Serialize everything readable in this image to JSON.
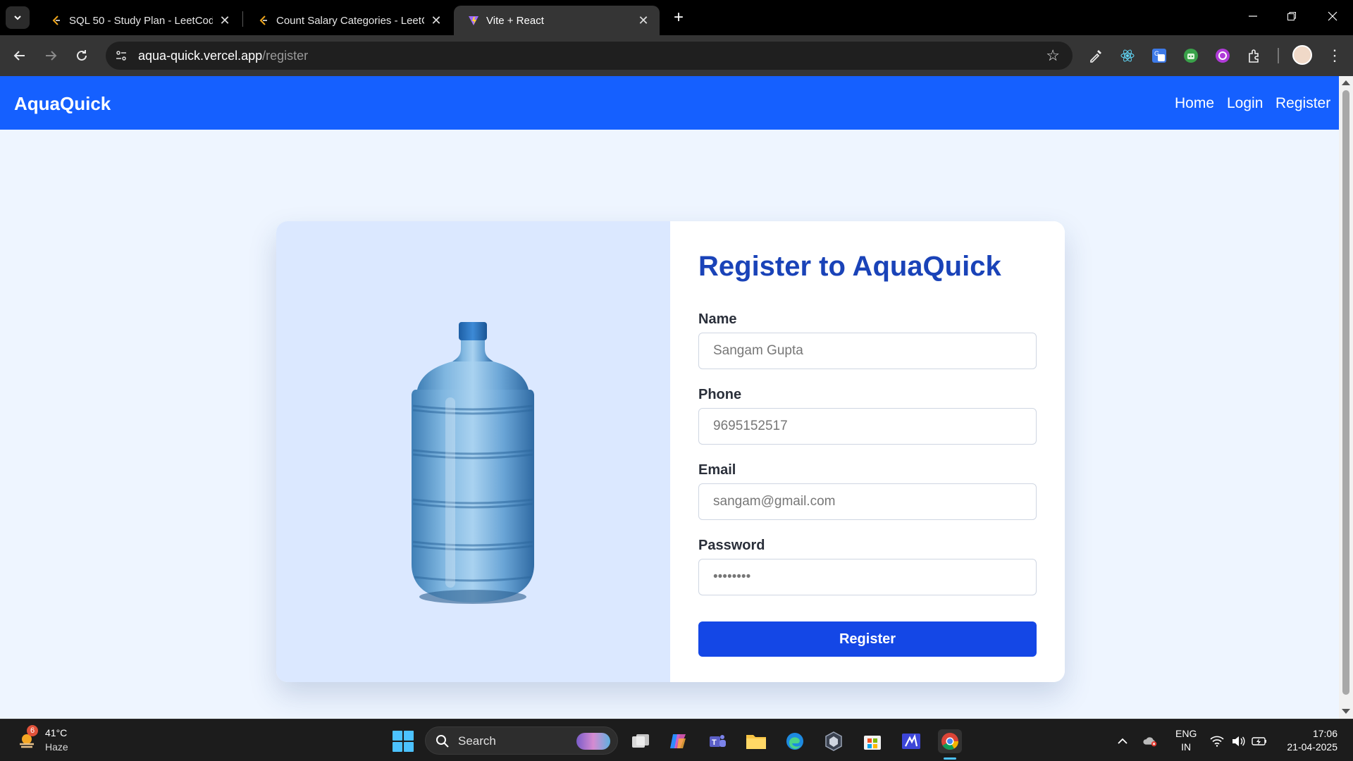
{
  "browser": {
    "tabs": [
      {
        "title": "SQL 50 - Study Plan - LeetCode",
        "favicon": "leetcode-icon",
        "active": false
      },
      {
        "title": "Count Salary Categories - LeetC",
        "favicon": "leetcode-icon",
        "active": false
      },
      {
        "title": "Vite + React",
        "favicon": "vite-icon",
        "active": true
      }
    ],
    "url_host": "aqua-quick.vercel.app",
    "url_path": "/register"
  },
  "site": {
    "brand": "AquaQuick",
    "nav": {
      "home": "Home",
      "login": "Login",
      "register": "Register"
    },
    "colors": {
      "nav_bg": "#1560ff",
      "page_bg": "#eef5ff",
      "button": "#1447e6",
      "title": "#1a43b8"
    }
  },
  "form": {
    "title": "Register to AquaQuick",
    "fields": {
      "name": {
        "label": "Name",
        "placeholder": "Sangam Gupta"
      },
      "phone": {
        "label": "Phone",
        "placeholder": "9695152517"
      },
      "email": {
        "label": "Email",
        "placeholder": "sangam@gmail.com"
      },
      "password": {
        "label": "Password",
        "placeholder": "••••••••"
      }
    },
    "submit_label": "Register"
  },
  "taskbar": {
    "weather": {
      "temp": "41°C",
      "condition": "Haze",
      "badge": "6"
    },
    "search_label": "Search",
    "lang": {
      "line1": "ENG",
      "line2": "IN"
    },
    "time": "17:06",
    "date": "21-04-2025"
  }
}
